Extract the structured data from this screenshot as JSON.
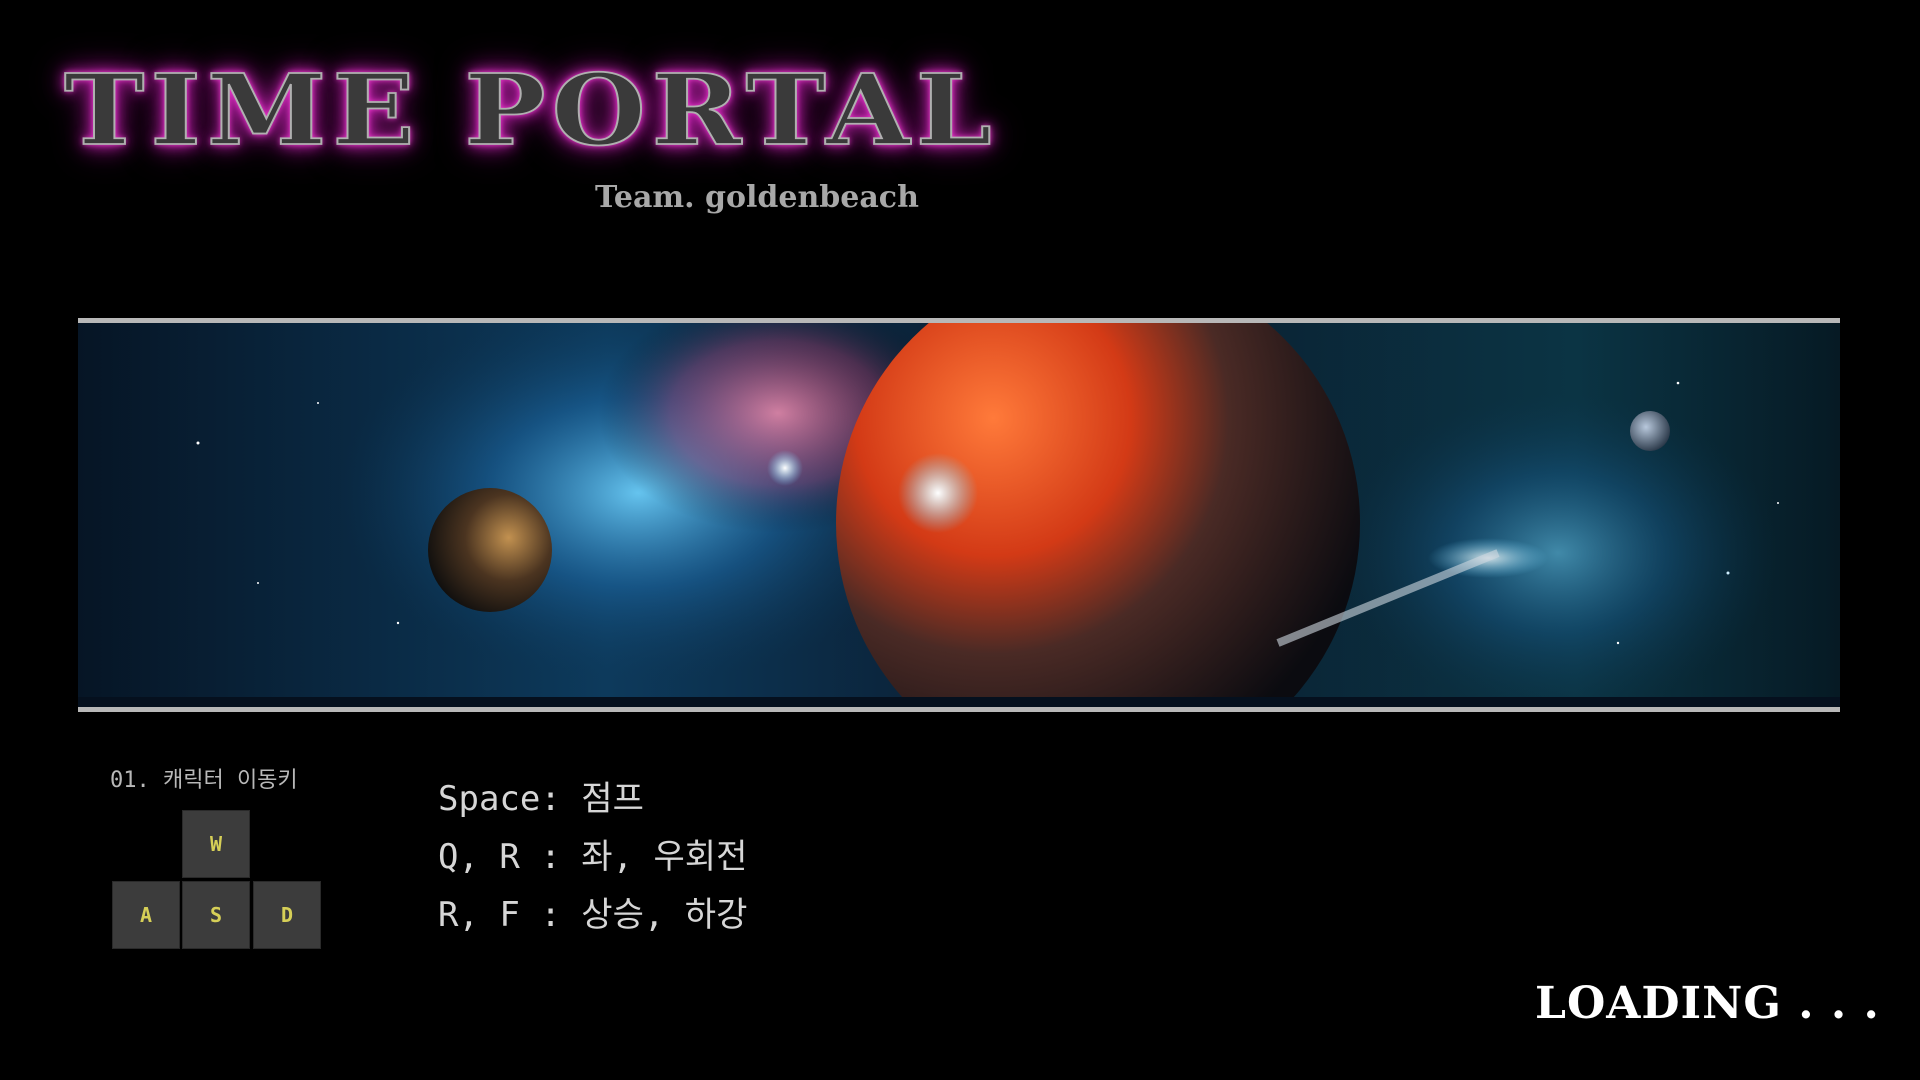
{
  "title": {
    "main": "TIME PORTAL",
    "team": "Team. goldenbeach"
  },
  "controls": {
    "heading": "01. 캐릭터 이동키",
    "keys": {
      "w": "W",
      "a": "A",
      "s": "S",
      "d": "D"
    },
    "instructions": [
      "Space: 점프",
      "Q, R : 좌, 우회전",
      "R, F : 상승, 하강"
    ]
  },
  "status": {
    "loading": "LOADING . . ."
  },
  "colors": {
    "title_glow": "#d62bc2",
    "key_text": "#d6cf57",
    "background": "#000000"
  }
}
